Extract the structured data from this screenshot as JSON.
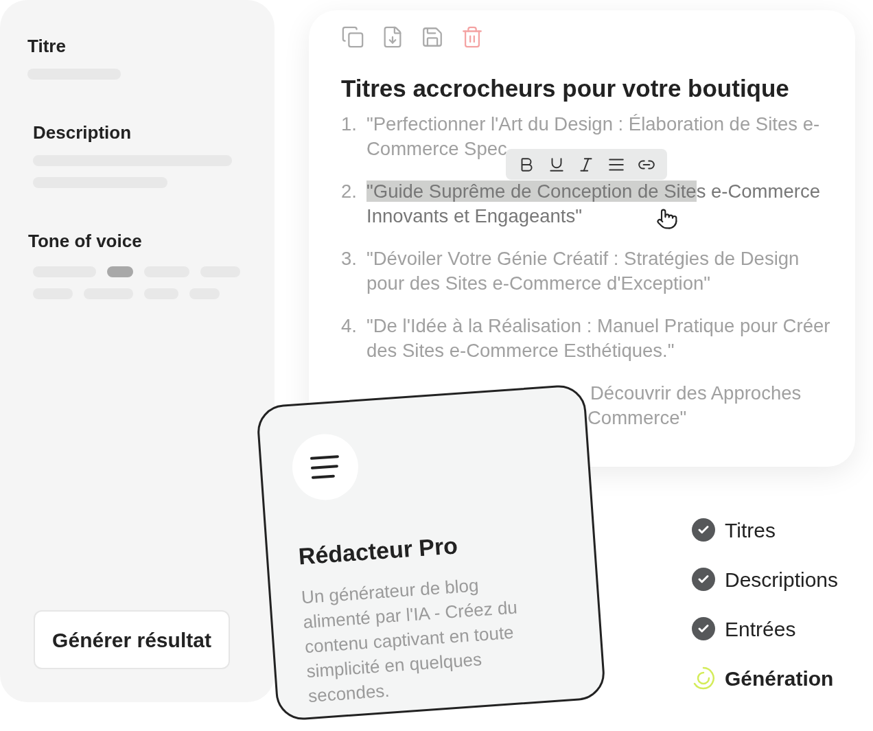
{
  "form": {
    "fields": [
      {
        "label": "Titre",
        "kind": "text"
      },
      {
        "label": "Description",
        "kind": "textarea"
      },
      {
        "label": "Tone of voice",
        "kind": "chips"
      }
    ],
    "tone_options": [
      {
        "selected": false
      },
      {
        "selected": true
      },
      {
        "selected": false
      },
      {
        "selected": false
      },
      {
        "selected": false
      },
      {
        "selected": false
      },
      {
        "selected": false
      },
      {
        "selected": false
      }
    ],
    "generate_button": "Générer résultat"
  },
  "editor": {
    "toolbar": [
      {
        "kind": "copy"
      },
      {
        "kind": "download"
      },
      {
        "kind": "save"
      },
      {
        "kind": "delete"
      }
    ],
    "title": "Titres accrocheurs pour votre boutique",
    "items": [
      {
        "number": "1.",
        "text": "\"Perfectionner l'Art du Design : Élaboration de Sites e-Commerce Spec"
      },
      {
        "number": "2.",
        "selected_text": "\"Guide Suprême de Conception de Site",
        "text": "s e-Commerce Innovants et Engageants\""
      },
      {
        "number": "3.",
        "text": "\"Dévoiler Votre Génie Créatif : Stratégies de Design pour des Sites e-Commerce d'Exception\""
      },
      {
        "number": "4.",
        "text": "\"De l'Idée à la Réalisation : Manuel Pratique pour Créer des Sites e-Commerce Esthétiques.\""
      }
    ],
    "partial_item": [
      "Découvrir des Approches",
      "Commerce\""
    ],
    "format_bar": [
      {
        "kind": "bold"
      },
      {
        "kind": "underline"
      },
      {
        "kind": "italic"
      },
      {
        "kind": "align"
      },
      {
        "kind": "link"
      }
    ]
  },
  "card": {
    "title": "Rédacteur Pro",
    "description": "Un générateur de blog alimenté par l'IA - Créez du contenu captivant en toute simplicité en quelques secondes."
  },
  "steps": [
    {
      "label": "Titres",
      "done": true
    },
    {
      "label": "Descriptions",
      "done": true
    },
    {
      "label": "Entrées",
      "done": true
    },
    {
      "label": "Génération",
      "done": false
    }
  ]
}
